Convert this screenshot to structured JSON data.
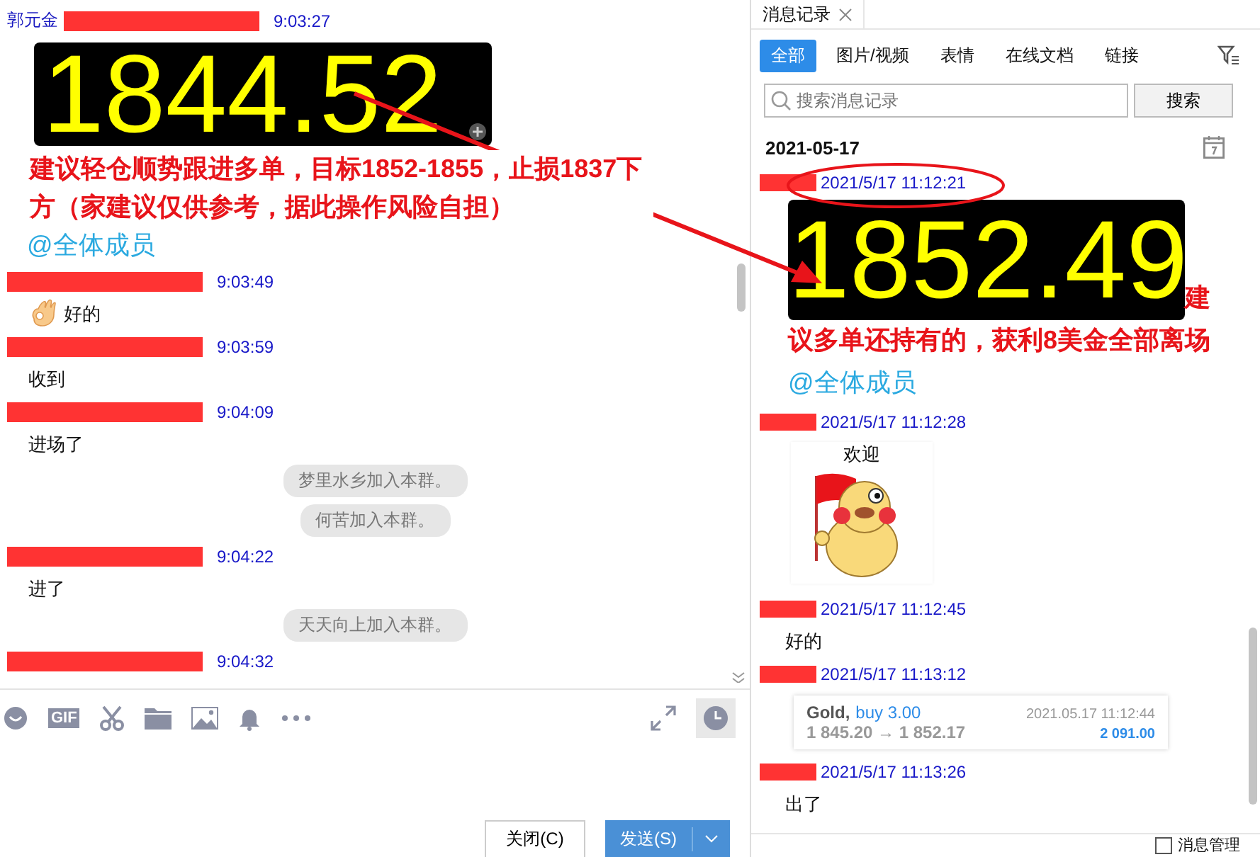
{
  "chat": {
    "messages": [
      {
        "kind": "price",
        "sender": "郭元金",
        "time": "9:03:27",
        "price": "1844.52",
        "text": "建议轻仓顺势跟进多单，目标1852-1855，止损1837下方（家建议仅供参考，据此操作风险自担）",
        "mention": "@全体成员"
      },
      {
        "kind": "emoji_text",
        "time": "9:03:49",
        "text": "好的"
      },
      {
        "kind": "text",
        "time": "9:03:59",
        "text": "收到"
      },
      {
        "kind": "text",
        "time": "9:04:09",
        "text": "进场了"
      },
      {
        "kind": "system",
        "text": "梦里水乡加入本群。"
      },
      {
        "kind": "system",
        "text": "何苦加入本群。"
      },
      {
        "kind": "text",
        "time": "9:04:22",
        "text": "进了"
      },
      {
        "kind": "system",
        "text": "天天向上加入本群。"
      },
      {
        "kind": "text",
        "time": "9:04:32"
      }
    ]
  },
  "toolbar": {
    "gif_label": "GIF"
  },
  "buttons": {
    "close": "关闭(C)",
    "send": "发送(S)"
  },
  "history": {
    "tab_title": "消息记录",
    "filters": [
      {
        "label": "全部",
        "selected": true
      },
      {
        "label": "图片/视频",
        "selected": false
      },
      {
        "label": "表情",
        "selected": false
      },
      {
        "label": "在线文档",
        "selected": false
      },
      {
        "label": "链接",
        "selected": false
      }
    ],
    "search": {
      "placeholder": "搜索消息记录",
      "button": "搜索"
    },
    "date": "2021-05-17",
    "messages": [
      {
        "kind": "price",
        "time": "2021/5/17 11:12:21",
        "price": "1852.49",
        "text": "建议多单还持有的，获利8美金全部离场",
        "mention": "@全体成员"
      },
      {
        "kind": "sticker",
        "time": "2021/5/17 11:12:28",
        "caption": "欢迎"
      },
      {
        "kind": "text",
        "time": "2021/5/17 11:12:45",
        "text": "好的"
      },
      {
        "kind": "trade",
        "time": "2021/5/17 11:13:12",
        "symbol": "Gold,",
        "side": "buy 3.00",
        "opened": "2021.05.17 11:12:44",
        "prices": "1 845.20 → 1 852.17",
        "profit": "2 091.00"
      },
      {
        "kind": "text",
        "time": "2021/5/17 11:13:26",
        "text": "出了"
      }
    ],
    "manage": {
      "label": "消息管理",
      "checked": false
    }
  }
}
